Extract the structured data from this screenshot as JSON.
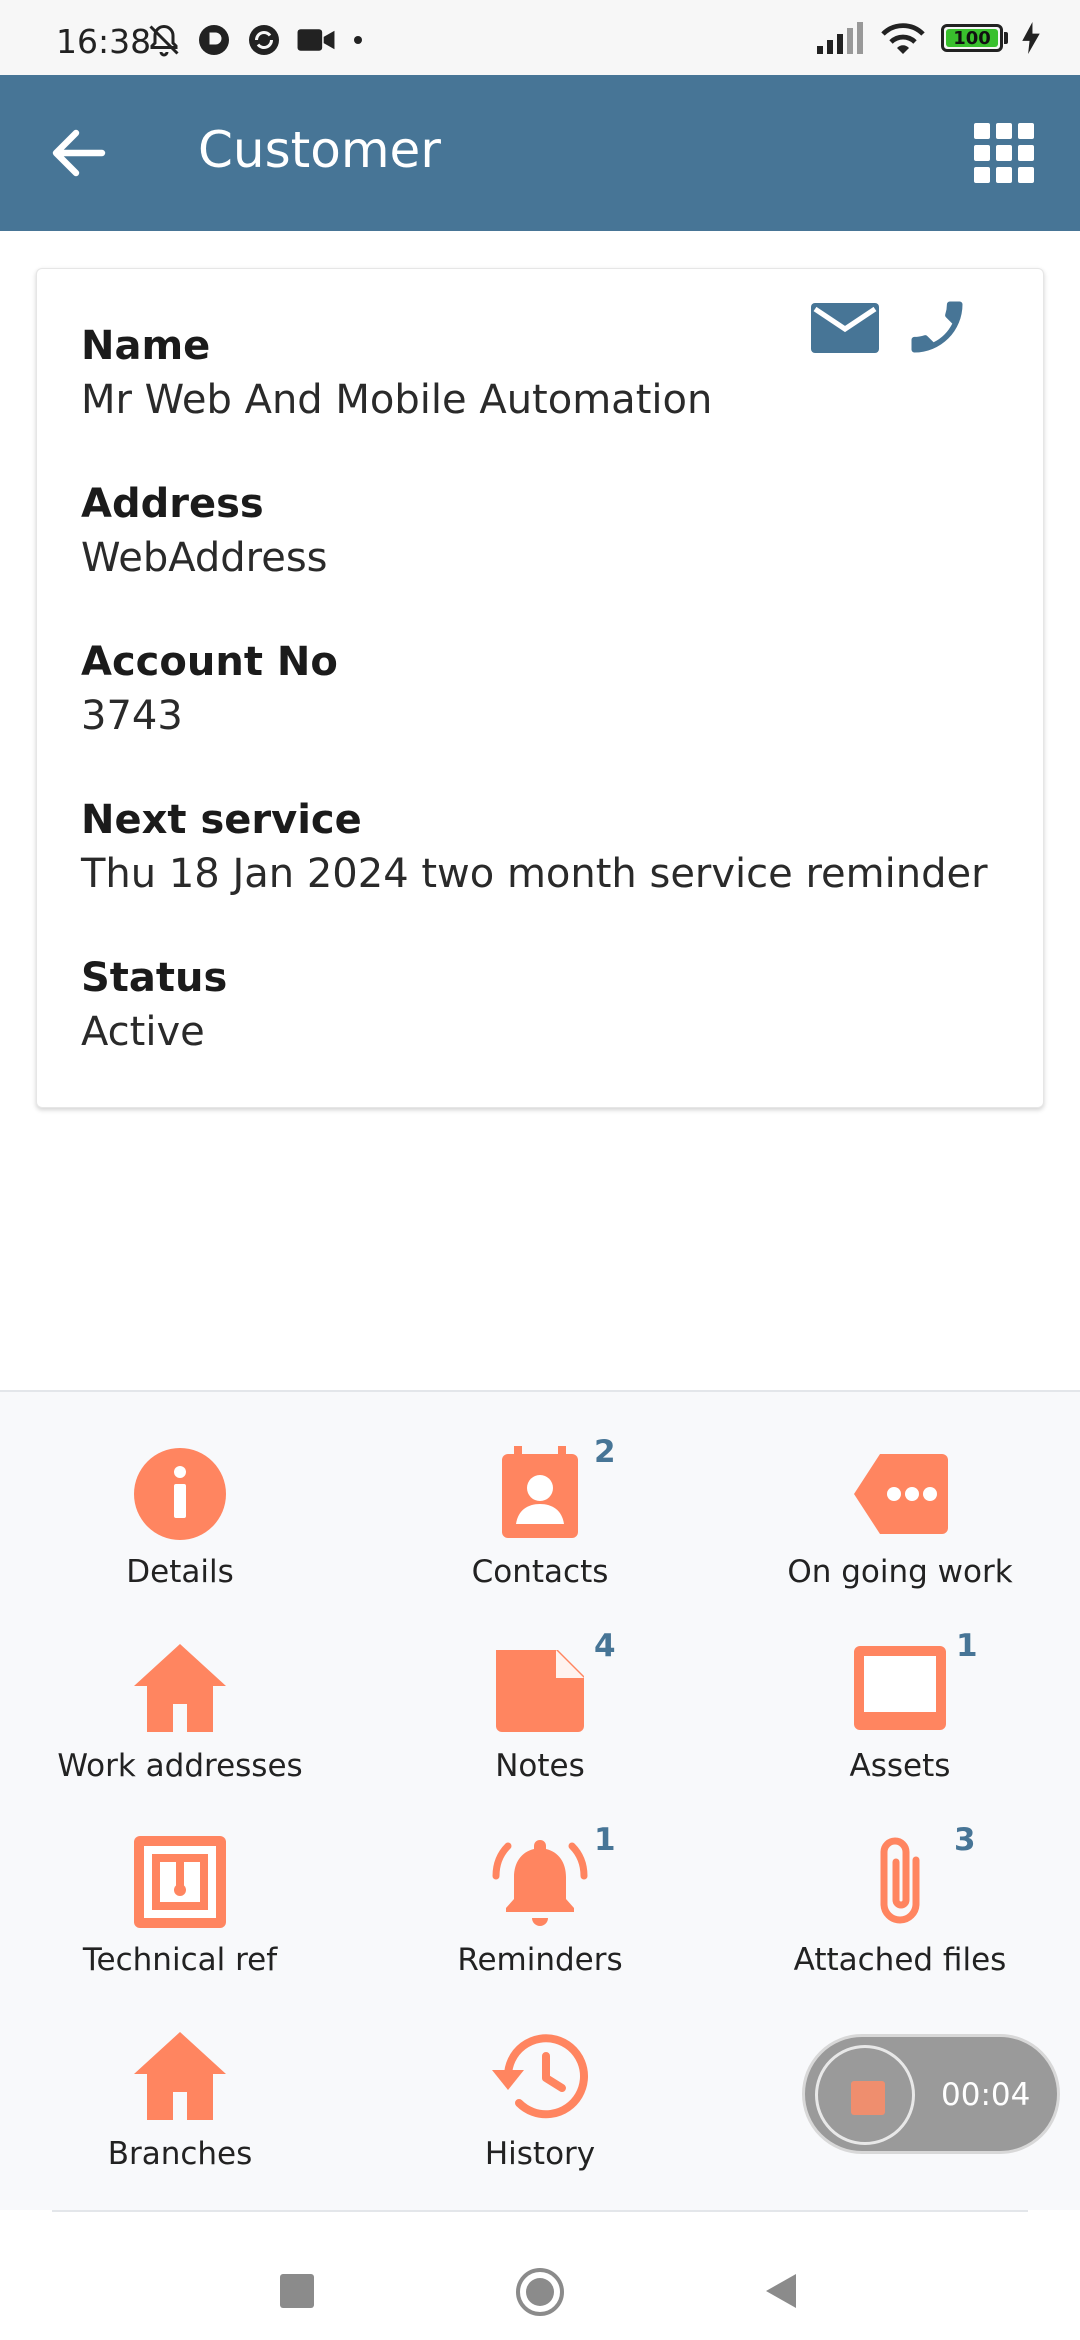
{
  "status_bar": {
    "time": "16:38",
    "battery": "100",
    "icons": [
      "mute-bell-icon",
      "app-icon",
      "sync-icon",
      "video-icon",
      "dot-icon",
      "signal-icon",
      "wifi-icon",
      "battery-icon",
      "charging-icon"
    ]
  },
  "app_bar": {
    "title": "Customer",
    "background": "#477596",
    "icons": [
      "back-arrow-icon",
      "apps-grid-icon"
    ]
  },
  "customer": {
    "fields": [
      {
        "label": "Name",
        "value": "Mr Web And Mobile Automation"
      },
      {
        "label": "Address",
        "value": "WebAddress"
      },
      {
        "label": "Account No",
        "value": "3743"
      },
      {
        "label": "Next service",
        "value": "Thu 18 Jan 2024 two month service reminder"
      },
      {
        "label": "Status",
        "value": "Active"
      }
    ],
    "actions": [
      "mail-icon",
      "phone-icon"
    ]
  },
  "menu": {
    "accent": "#FF8560",
    "badge_color": "#477596",
    "items": [
      {
        "label": "Details",
        "icon": "info-icon",
        "badge": ""
      },
      {
        "label": "Contacts",
        "icon": "contact-card-icon",
        "badge": "2"
      },
      {
        "label": "On going work",
        "icon": "tag-more-icon",
        "badge": ""
      },
      {
        "label": "Work addresses",
        "icon": "home-icon",
        "badge": ""
      },
      {
        "label": "Notes",
        "icon": "note-icon",
        "badge": "4"
      },
      {
        "label": "Assets",
        "icon": "tablet-icon",
        "badge": "1"
      },
      {
        "label": "Technical ref",
        "icon": "nfc-icon",
        "badge": ""
      },
      {
        "label": "Reminders",
        "icon": "bell-ring-icon",
        "badge": "1"
      },
      {
        "label": "Attached files",
        "icon": "paperclip-icon",
        "badge": "3"
      },
      {
        "label": "Branches",
        "icon": "home-icon",
        "badge": ""
      },
      {
        "label": "History",
        "icon": "history-icon",
        "badge": ""
      }
    ]
  },
  "recorder": {
    "time": "00:04"
  },
  "nav_bar": {
    "icons": [
      "recents-square-icon",
      "home-circle-icon",
      "back-triangle-icon"
    ]
  }
}
